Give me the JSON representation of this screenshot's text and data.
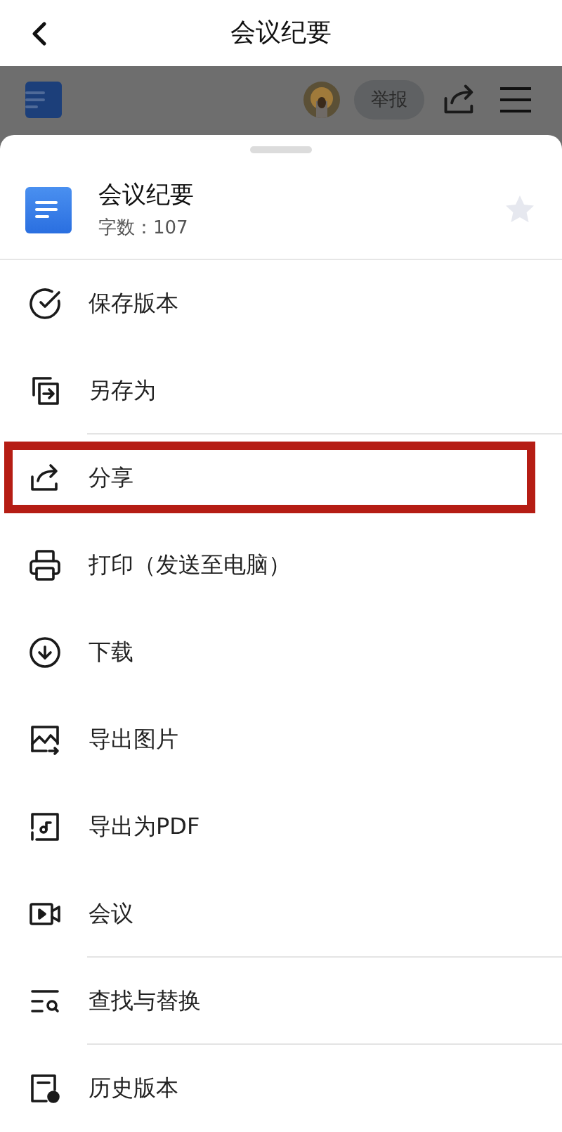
{
  "header": {
    "title": "会议纪要"
  },
  "toolbar": {
    "report_button": "举报"
  },
  "document": {
    "title": "会议纪要",
    "word_count": "字数：107",
    "starred": false
  },
  "menu": [
    {
      "label": "保存版本",
      "divider_after": false,
      "highlighted": false
    },
    {
      "label": "另存为",
      "divider_after": true,
      "highlighted": false
    },
    {
      "label": "分享",
      "divider_after": false,
      "highlighted": true
    },
    {
      "label": "打印（发送至电脑）",
      "divider_after": false,
      "highlighted": false
    },
    {
      "label": "下载",
      "divider_after": false,
      "highlighted": false
    },
    {
      "label": "导出图片",
      "divider_after": false,
      "highlighted": false
    },
    {
      "label": "导出为PDF",
      "divider_after": false,
      "highlighted": false
    },
    {
      "label": "会议",
      "divider_after": true,
      "highlighted": false
    },
    {
      "label": "查找与替换",
      "divider_after": true,
      "highlighted": false
    },
    {
      "label": "历史版本",
      "divider_after": false,
      "highlighted": false
    }
  ]
}
